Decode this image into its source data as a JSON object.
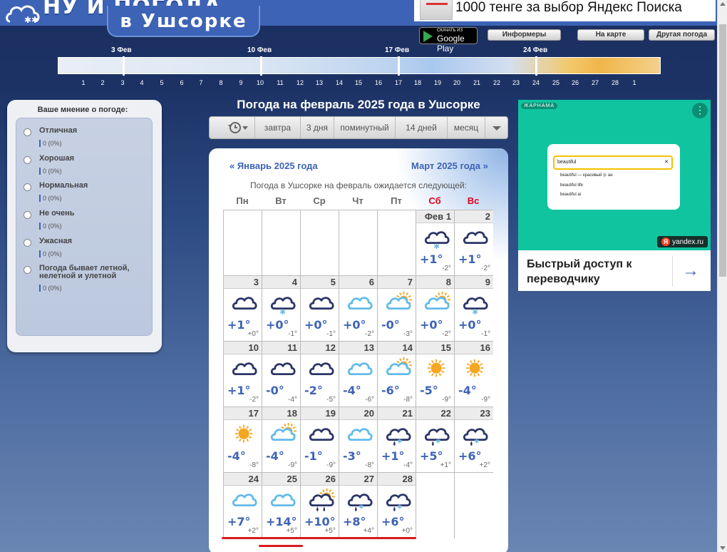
{
  "header": {
    "logo_text": "НУ И ПОГОДА",
    "logo_city": "в Ушсорке",
    "ad_text": "1000 тенге за выбор Яндекс Поиска"
  },
  "buttons": {
    "google_play_small": "СКАЧАТЬ ИЗ",
    "google_play": "Google Play",
    "informers": "Информеры",
    "on_map": "На карте",
    "other_weather": "Другая погода"
  },
  "timeline": {
    "week_labels": [
      "3 Фев",
      "10 Фев",
      "17 Фев",
      "24 Фев"
    ],
    "days": [
      "1",
      "2",
      "3",
      "4",
      "5",
      "6",
      "7",
      "8",
      "9",
      "10",
      "11",
      "12",
      "13",
      "14",
      "15",
      "16",
      "17",
      "18",
      "19",
      "20",
      "21",
      "22",
      "23",
      "24",
      "25",
      "26",
      "27",
      "28",
      "1"
    ]
  },
  "poll": {
    "title": "Ваше мнение о погоде:",
    "options": [
      {
        "label": "Отличная",
        "value": "0 (0%)"
      },
      {
        "label": "Хорошая",
        "value": "0 (0%)"
      },
      {
        "label": "Нормальная",
        "value": "0 (0%)"
      },
      {
        "label": "Не очень",
        "value": "0 (0%)"
      },
      {
        "label": "Ужасная",
        "value": "0 (0%)"
      },
      {
        "label": "Погода бывает летной, нелетной и улетной",
        "value": "0 (0%)"
      }
    ]
  },
  "calendar": {
    "title": "Погода на февраль 2025 года в Ушсорке",
    "tabs": [
      "завтра",
      "3 дня",
      "поминутный",
      "14 дней",
      "месяц"
    ],
    "prev": "« Январь 2025 года",
    "next": "Март 2025 года »",
    "expect": "Погода в Ушсорке на февраль ожидается следующей:",
    "weekdays": [
      "Пн",
      "Вт",
      "Ср",
      "Чт",
      "Пт",
      "Сб",
      "Вс"
    ],
    "month_short": "Фев",
    "colors": {
      "accent": "#3d63b6",
      "weekend": "#e0001a",
      "sun": "#f5a623"
    },
    "days": [
      {
        "d": "1",
        "icon": "cloud-snow-icon",
        "max": "+1°",
        "min": "-2°"
      },
      {
        "d": "2",
        "icon": "cloud-icon",
        "max": "+1°",
        "min": "-2°"
      },
      {
        "d": "3",
        "icon": "cloud-icon",
        "max": "+1°",
        "min": "+0°"
      },
      {
        "d": "4",
        "icon": "cloud-snow-icon",
        "max": "+0°",
        "min": "-1°"
      },
      {
        "d": "5",
        "icon": "cloud-icon",
        "max": "+0°",
        "min": "-1°"
      },
      {
        "d": "6",
        "icon": "light-cloud-icon",
        "max": "+0°",
        "min": "-2°"
      },
      {
        "d": "7",
        "icon": "sun-cloud-icon",
        "max": "-0°",
        "min": "-3°"
      },
      {
        "d": "8",
        "icon": "sun-cloud-icon",
        "max": "+0°",
        "min": "-2°"
      },
      {
        "d": "9",
        "icon": "cloud-snow-icon",
        "max": "+0°",
        "min": "-1°"
      },
      {
        "d": "10",
        "icon": "cloud-icon",
        "max": "+1°",
        "min": "-2°"
      },
      {
        "d": "11",
        "icon": "cloud-icon",
        "max": "-0°",
        "min": "-4°"
      },
      {
        "d": "12",
        "icon": "cloud-icon",
        "max": "-2°",
        "min": "-5°"
      },
      {
        "d": "13",
        "icon": "light-cloud-icon",
        "max": "-4°",
        "min": "-6°"
      },
      {
        "d": "14",
        "icon": "sun-cloud-icon",
        "max": "-6°",
        "min": "-8°"
      },
      {
        "d": "15",
        "icon": "sun-icon",
        "max": "-5°",
        "min": "-9°"
      },
      {
        "d": "16",
        "icon": "sun-icon",
        "max": "-4°",
        "min": "-9°"
      },
      {
        "d": "17",
        "icon": "sun-icon",
        "max": "-4°",
        "min": "-8°"
      },
      {
        "d": "18",
        "icon": "sun-cloud-icon",
        "max": "-4°",
        "min": "-9°"
      },
      {
        "d": "19",
        "icon": "cloud-icon",
        "max": "-1°",
        "min": "-9°"
      },
      {
        "d": "20",
        "icon": "light-cloud-icon",
        "max": "-3°",
        "min": "-8°"
      },
      {
        "d": "21",
        "icon": "cloud-rain-snow-icon",
        "max": "+1°",
        "min": "-4°"
      },
      {
        "d": "22",
        "icon": "cloud-rain-snow-icon",
        "max": "+5°",
        "min": "+1°"
      },
      {
        "d": "23",
        "icon": "cloud-rain-snow-icon",
        "max": "+6°",
        "min": "+2°"
      },
      {
        "d": "24",
        "icon": "light-cloud-icon",
        "max": "+7°",
        "min": "+2°"
      },
      {
        "d": "25",
        "icon": "light-cloud-icon",
        "max": "+14°",
        "min": "+5°"
      },
      {
        "d": "26",
        "icon": "sun-cloud-rain-icon",
        "max": "+10°",
        "min": "+5°"
      },
      {
        "d": "27",
        "icon": "cloud-rain-snow-icon",
        "max": "+8°",
        "min": "+4°"
      },
      {
        "d": "28",
        "icon": "cloud-rain-snow-icon",
        "max": "+6°",
        "min": "+0°"
      }
    ]
  },
  "ad": {
    "badge": "ЖАРНАМА",
    "search_text": "beautiful",
    "suggestions": [
      "beautiful — красивый (с ан",
      "beautiful life",
      "beautiful ai"
    ],
    "brand": "yandex.ru",
    "text": "Быстрый доступ к переводчику"
  }
}
